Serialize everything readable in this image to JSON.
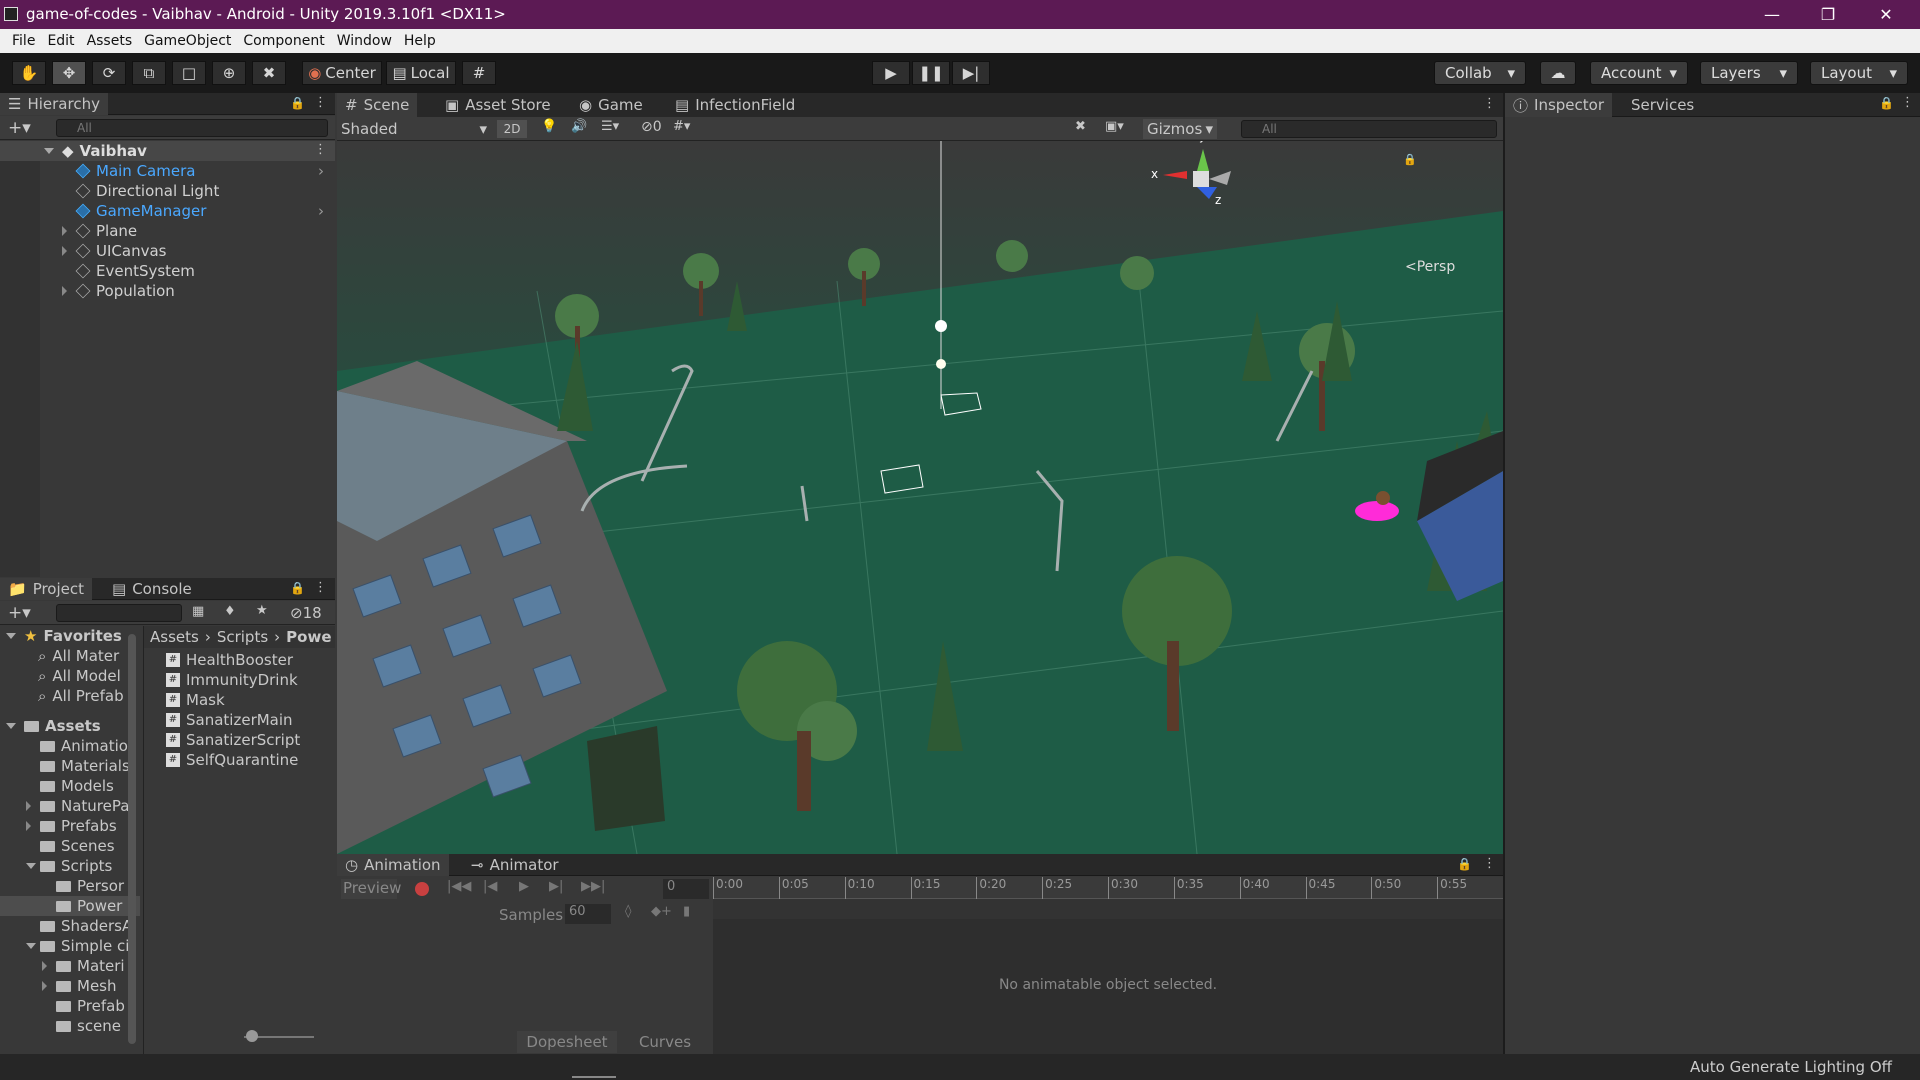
{
  "window": {
    "title": "game-of-codes - Vaibhav - Android - Unity 2019.3.10f1 <DX11>"
  },
  "menu": [
    "File",
    "Edit",
    "Assets",
    "GameObject",
    "Component",
    "Window",
    "Help"
  ],
  "toolbar": {
    "center": "Center",
    "local": "Local",
    "collab": "Collab",
    "account": "Account",
    "layers": "Layers",
    "layout": "Layout"
  },
  "hierarchy": {
    "tab": "Hierarchy",
    "search": "All",
    "scene": "Vaibhav",
    "items": [
      {
        "label": "Main Camera",
        "highlight": true,
        "expandable": false
      },
      {
        "label": "Directional Light",
        "highlight": false,
        "expandable": false
      },
      {
        "label": "GameManager",
        "highlight": true,
        "expandable": false
      },
      {
        "label": "Plane",
        "highlight": false,
        "expandable": true
      },
      {
        "label": "UICanvas",
        "highlight": false,
        "expandable": true
      },
      {
        "label": "EventSystem",
        "highlight": false,
        "expandable": false
      },
      {
        "label": "Population",
        "highlight": false,
        "expandable": true
      }
    ]
  },
  "scene_tabs": [
    "Scene",
    "Asset Store",
    "Game",
    "InfectionField"
  ],
  "scene_toolbar": {
    "shading": "Shaded",
    "mode2d": "2D",
    "hidden_count": "0",
    "gizmos": "Gizmos",
    "search": "All",
    "persp": "Persp",
    "axis_x": "x",
    "axis_y": "y",
    "axis_z": "z"
  },
  "project": {
    "tabs": [
      "Project",
      "Console"
    ],
    "hidden_count": "18",
    "breadcrumb": [
      "Assets",
      "Scripts",
      "Powe"
    ],
    "favorites_label": "Favorites",
    "favorites": [
      "All Mater",
      "All Model",
      "All Prefab"
    ],
    "assets_label": "Assets",
    "tree": [
      {
        "label": "Animatio",
        "indent": 1,
        "expand": ""
      },
      {
        "label": "Materials",
        "indent": 1,
        "expand": ""
      },
      {
        "label": "Models",
        "indent": 1,
        "expand": ""
      },
      {
        "label": "NaturePa",
        "indent": 1,
        "expand": "right"
      },
      {
        "label": "Prefabs",
        "indent": 1,
        "expand": "right"
      },
      {
        "label": "Scenes",
        "indent": 1,
        "expand": ""
      },
      {
        "label": "Scripts",
        "indent": 1,
        "expand": "down"
      },
      {
        "label": "Persor",
        "indent": 2,
        "expand": ""
      },
      {
        "label": "Power",
        "indent": 2,
        "expand": "",
        "selected": true
      },
      {
        "label": "ShadersA",
        "indent": 1,
        "expand": ""
      },
      {
        "label": "Simple ci",
        "indent": 1,
        "expand": "down"
      },
      {
        "label": "Materi",
        "indent": 2,
        "expand": "right"
      },
      {
        "label": "Mesh",
        "indent": 2,
        "expand": "right"
      },
      {
        "label": "Prefab",
        "indent": 2,
        "expand": ""
      },
      {
        "label": "scene",
        "indent": 2,
        "expand": ""
      }
    ],
    "files": [
      "HealthBooster",
      "ImmunityDrink",
      "Mask",
      "SanatizerMain",
      "SanatizerScript",
      "SelfQuarantine"
    ]
  },
  "animation": {
    "tabs": [
      "Animation",
      "Animator"
    ],
    "preview": "Preview",
    "frame": "0",
    "samples_label": "Samples",
    "samples": "60",
    "ticks": [
      "0:00",
      "0:05",
      "0:10",
      "0:15",
      "0:20",
      "0:25",
      "0:30",
      "0:35",
      "0:40",
      "0:45",
      "0:50",
      "0:55"
    ],
    "empty_message": "No animatable object selected.",
    "dopesheet": "Dopesheet",
    "curves": "Curves"
  },
  "inspector": {
    "tabs": [
      "Inspector",
      "Services"
    ]
  },
  "status": {
    "text": "Auto Generate Lighting Off"
  },
  "colors": {
    "title_bar": "#5c1a54",
    "ground": "#1e5c46",
    "selection_blue": "#4aa8ff",
    "magenta_marker": "#ff2bd8"
  }
}
